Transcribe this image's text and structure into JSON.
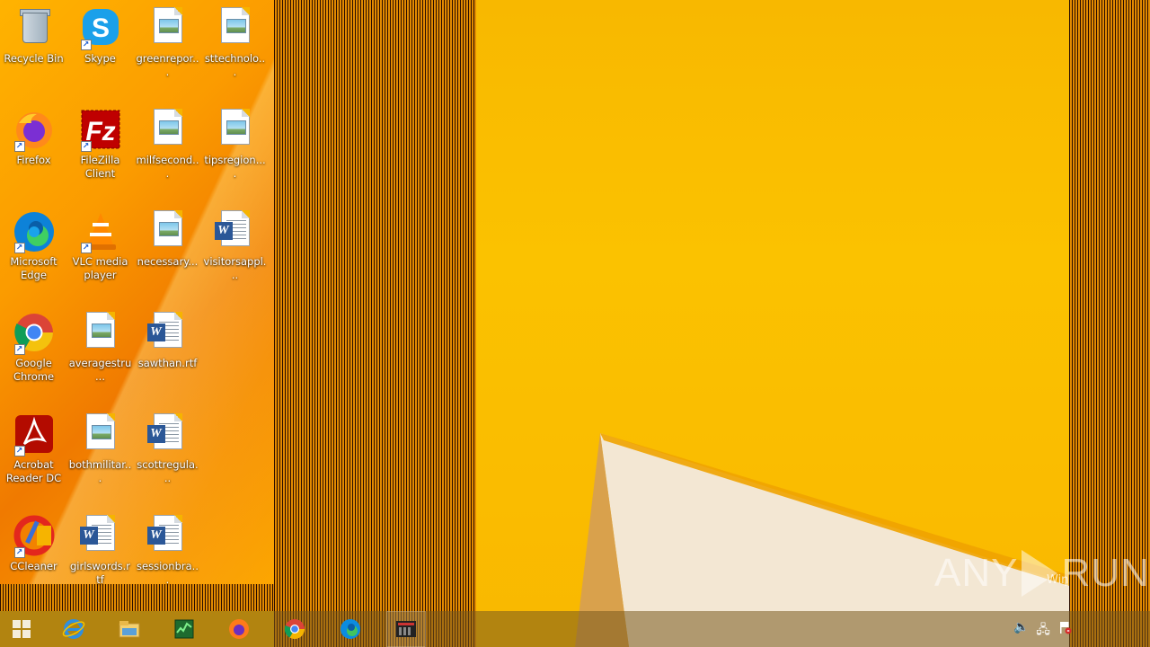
{
  "desktop": {
    "icons": [
      {
        "label": "Recycle Bin",
        "kind": "recycle-bin"
      },
      {
        "label": "Skype",
        "kind": "skype",
        "shortcut": true
      },
      {
        "label": "greenrepor...",
        "kind": "image-file"
      },
      {
        "label": "sttechnolo...",
        "kind": "image-file"
      },
      {
        "label": "Firefox",
        "kind": "firefox",
        "shortcut": true
      },
      {
        "label": "FileZilla Client",
        "kind": "filezilla",
        "shortcut": true
      },
      {
        "label": "milfsecond...",
        "kind": "image-file"
      },
      {
        "label": "tipsregion....",
        "kind": "image-file"
      },
      {
        "label": "Microsoft Edge",
        "kind": "edge",
        "shortcut": true
      },
      {
        "label": "VLC media player",
        "kind": "vlc",
        "shortcut": true
      },
      {
        "label": "necessary...",
        "kind": "image-file"
      },
      {
        "label": "visitorsappl...",
        "kind": "word-doc"
      },
      {
        "label": "Google Chrome",
        "kind": "chrome",
        "shortcut": true
      },
      {
        "label": "averagestru...",
        "kind": "image-file"
      },
      {
        "label": "sawthan.rtf",
        "kind": "word-doc"
      },
      {
        "label": "Acrobat Reader DC",
        "kind": "acrobat",
        "shortcut": true
      },
      {
        "label": "bothmilitar...",
        "kind": "image-file"
      },
      {
        "label": "scottregula...",
        "kind": "word-doc"
      },
      {
        "label": "CCleaner",
        "kind": "ccleaner",
        "shortcut": true
      },
      {
        "label": "girlswords.rtf",
        "kind": "word-doc"
      },
      {
        "label": "sessionbra...",
        "kind": "word-doc"
      }
    ]
  },
  "watermark": {
    "text_left": "ANY",
    "text_right": "RUN",
    "small": "Win"
  },
  "taskbar": {
    "buttons": [
      {
        "icon": "start-icon"
      },
      {
        "icon": "internet-explorer-icon"
      },
      {
        "icon": "file-explorer-icon"
      },
      {
        "icon": "task-manager-icon"
      },
      {
        "icon": "firefox-icon"
      },
      {
        "icon": "chrome-icon"
      },
      {
        "icon": "edge-icon"
      },
      {
        "icon": "app-icon"
      }
    ],
    "tray": [
      {
        "icon": "speaker-icon",
        "glyph": "🔈"
      },
      {
        "icon": "network-icon",
        "glyph": "🖧"
      },
      {
        "icon": "flag-icon",
        "glyph": "⚑"
      }
    ]
  },
  "colors": {
    "wallpaper": "#f6b400",
    "word_blue": "#2b5797"
  }
}
